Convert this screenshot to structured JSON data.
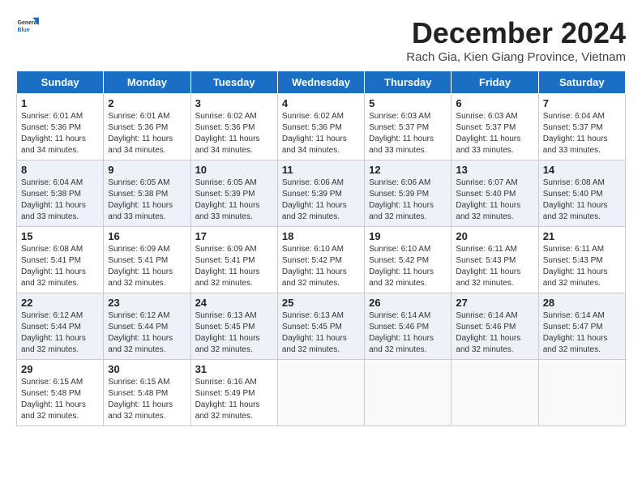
{
  "header": {
    "logo_general": "General",
    "logo_blue": "Blue",
    "title": "December 2024",
    "subtitle": "Rach Gia, Kien Giang Province, Vietnam"
  },
  "days_of_week": [
    "Sunday",
    "Monday",
    "Tuesday",
    "Wednesday",
    "Thursday",
    "Friday",
    "Saturday"
  ],
  "weeks": [
    [
      {
        "day": "1",
        "sunrise": "6:01 AM",
        "sunset": "5:36 PM",
        "daylight": "11 hours and 34 minutes."
      },
      {
        "day": "2",
        "sunrise": "6:01 AM",
        "sunset": "5:36 PM",
        "daylight": "11 hours and 34 minutes."
      },
      {
        "day": "3",
        "sunrise": "6:02 AM",
        "sunset": "5:36 PM",
        "daylight": "11 hours and 34 minutes."
      },
      {
        "day": "4",
        "sunrise": "6:02 AM",
        "sunset": "5:36 PM",
        "daylight": "11 hours and 34 minutes."
      },
      {
        "day": "5",
        "sunrise": "6:03 AM",
        "sunset": "5:37 PM",
        "daylight": "11 hours and 33 minutes."
      },
      {
        "day": "6",
        "sunrise": "6:03 AM",
        "sunset": "5:37 PM",
        "daylight": "11 hours and 33 minutes."
      },
      {
        "day": "7",
        "sunrise": "6:04 AM",
        "sunset": "5:37 PM",
        "daylight": "11 hours and 33 minutes."
      }
    ],
    [
      {
        "day": "8",
        "sunrise": "6:04 AM",
        "sunset": "5:38 PM",
        "daylight": "11 hours and 33 minutes."
      },
      {
        "day": "9",
        "sunrise": "6:05 AM",
        "sunset": "5:38 PM",
        "daylight": "11 hours and 33 minutes."
      },
      {
        "day": "10",
        "sunrise": "6:05 AM",
        "sunset": "5:39 PM",
        "daylight": "11 hours and 33 minutes."
      },
      {
        "day": "11",
        "sunrise": "6:06 AM",
        "sunset": "5:39 PM",
        "daylight": "11 hours and 32 minutes."
      },
      {
        "day": "12",
        "sunrise": "6:06 AM",
        "sunset": "5:39 PM",
        "daylight": "11 hours and 32 minutes."
      },
      {
        "day": "13",
        "sunrise": "6:07 AM",
        "sunset": "5:40 PM",
        "daylight": "11 hours and 32 minutes."
      },
      {
        "day": "14",
        "sunrise": "6:08 AM",
        "sunset": "5:40 PM",
        "daylight": "11 hours and 32 minutes."
      }
    ],
    [
      {
        "day": "15",
        "sunrise": "6:08 AM",
        "sunset": "5:41 PM",
        "daylight": "11 hours and 32 minutes."
      },
      {
        "day": "16",
        "sunrise": "6:09 AM",
        "sunset": "5:41 PM",
        "daylight": "11 hours and 32 minutes."
      },
      {
        "day": "17",
        "sunrise": "6:09 AM",
        "sunset": "5:41 PM",
        "daylight": "11 hours and 32 minutes."
      },
      {
        "day": "18",
        "sunrise": "6:10 AM",
        "sunset": "5:42 PM",
        "daylight": "11 hours and 32 minutes."
      },
      {
        "day": "19",
        "sunrise": "6:10 AM",
        "sunset": "5:42 PM",
        "daylight": "11 hours and 32 minutes."
      },
      {
        "day": "20",
        "sunrise": "6:11 AM",
        "sunset": "5:43 PM",
        "daylight": "11 hours and 32 minutes."
      },
      {
        "day": "21",
        "sunrise": "6:11 AM",
        "sunset": "5:43 PM",
        "daylight": "11 hours and 32 minutes."
      }
    ],
    [
      {
        "day": "22",
        "sunrise": "6:12 AM",
        "sunset": "5:44 PM",
        "daylight": "11 hours and 32 minutes."
      },
      {
        "day": "23",
        "sunrise": "6:12 AM",
        "sunset": "5:44 PM",
        "daylight": "11 hours and 32 minutes."
      },
      {
        "day": "24",
        "sunrise": "6:13 AM",
        "sunset": "5:45 PM",
        "daylight": "11 hours and 32 minutes."
      },
      {
        "day": "25",
        "sunrise": "6:13 AM",
        "sunset": "5:45 PM",
        "daylight": "11 hours and 32 minutes."
      },
      {
        "day": "26",
        "sunrise": "6:14 AM",
        "sunset": "5:46 PM",
        "daylight": "11 hours and 32 minutes."
      },
      {
        "day": "27",
        "sunrise": "6:14 AM",
        "sunset": "5:46 PM",
        "daylight": "11 hours and 32 minutes."
      },
      {
        "day": "28",
        "sunrise": "6:14 AM",
        "sunset": "5:47 PM",
        "daylight": "11 hours and 32 minutes."
      }
    ],
    [
      {
        "day": "29",
        "sunrise": "6:15 AM",
        "sunset": "5:48 PM",
        "daylight": "11 hours and 32 minutes."
      },
      {
        "day": "30",
        "sunrise": "6:15 AM",
        "sunset": "5:48 PM",
        "daylight": "11 hours and 32 minutes."
      },
      {
        "day": "31",
        "sunrise": "6:16 AM",
        "sunset": "5:49 PM",
        "daylight": "11 hours and 32 minutes."
      },
      null,
      null,
      null,
      null
    ]
  ]
}
